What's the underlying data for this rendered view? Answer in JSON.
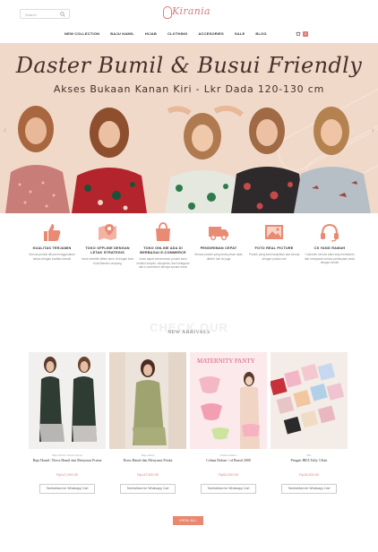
{
  "header": {
    "search_placeholder": "Search",
    "logo_text": "Kirania",
    "nav": [
      "NEW COLLECTION",
      "BAJU HAMIL",
      "HIJAB",
      "CLOTHING",
      "ACCESORIES",
      "SALE",
      "BLOG"
    ],
    "cart_count": "0"
  },
  "hero": {
    "title": "Daster Bumil & Busui Friendly",
    "subtitle": "Akses Bukaan Kanan Kiri - Lkr Dada 120-130 cm"
  },
  "features": [
    {
      "icon": "thumbs-up-icon",
      "title": "KUALITAS TERJAMIN",
      "text": "Semua produk dibuat menggunakan bahan dengan kualitas terbaik"
    },
    {
      "icon": "map-pin-icon",
      "title": "TOKO OFFLINE DENGAN LETAK STRATEGIS",
      "text": "Kami memiliki offline store di tengah kota Kota Bandar Lampung"
    },
    {
      "icon": "shopping-bag-icon",
      "title": "TOKO ONLINE ADA DI BERBAGAI E-COMMERCE",
      "text": "Anda dapat menemukan produk kami melalui shopee, tokopedia, dan instagram dan e-commerce lainnya secara resmi"
    },
    {
      "icon": "truck-icon",
      "title": "PENGIRIMAN CEPAT",
      "text": "Semua produk yang anda pesan akan dikirim hari itu juga"
    },
    {
      "icon": "photo-icon",
      "title": "FOTO REAL PICTURE",
      "text": "Produk yang kami tampilkan ada sesuai dengan produk asli"
    },
    {
      "icon": "headset-icon",
      "title": "CS YANG RAMAH",
      "text": "Customer service kami siap membantu dan menjawab semua pertanyaan anda dengan ramah"
    }
  ],
  "sections": {
    "check_our": "CHECK OUR",
    "new_arrivals": "NEW ARRIVALS"
  },
  "products": [
    {
      "category": "Baju Hamil / Dress Hamil",
      "name": "Baju Hamil / Dress Hamil dan Menyusui Prema",
      "price": "Rp147,000.00",
      "button": "Tambahkan ke Whatsapp Cart"
    },
    {
      "category": "Baju Hamil",
      "name": "Dress Hamil dan Menyusui Priska",
      "price": "Rp147,000.00",
      "button": "Tambahkan ke Whatsapp Cart"
    },
    {
      "category": "Celana Dalam",
      "name": "Celana Dalam / cd Bumil 2000",
      "price": "Rp52,000.00",
      "button": "Tambahkan ke Whatsapp Cart"
    },
    {
      "category": "Bra",
      "name": "Pengait BRA Tally 3 Kait",
      "price": "Rp15,000.00",
      "button": "Tambahkan ke Whatsapp Cart"
    }
  ],
  "view_all": "VIEW ALL",
  "product_image_text": {
    "maternity_panty": "MATERNITY PANTY"
  },
  "colors": {
    "accent": "#e07a7a",
    "button": "#e9886f",
    "hero_bg": "#f1d9c9"
  }
}
